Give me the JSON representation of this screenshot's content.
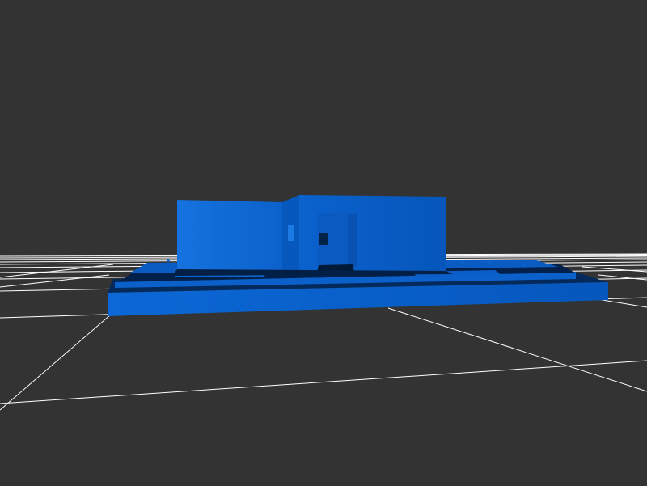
{
  "viewport": {
    "background_color": "#333333",
    "grid_color": "#ffffff",
    "model_color": "#0a63d1",
    "model_shade_color": "#0755b8",
    "model_shadow_color": "#042a5c"
  }
}
